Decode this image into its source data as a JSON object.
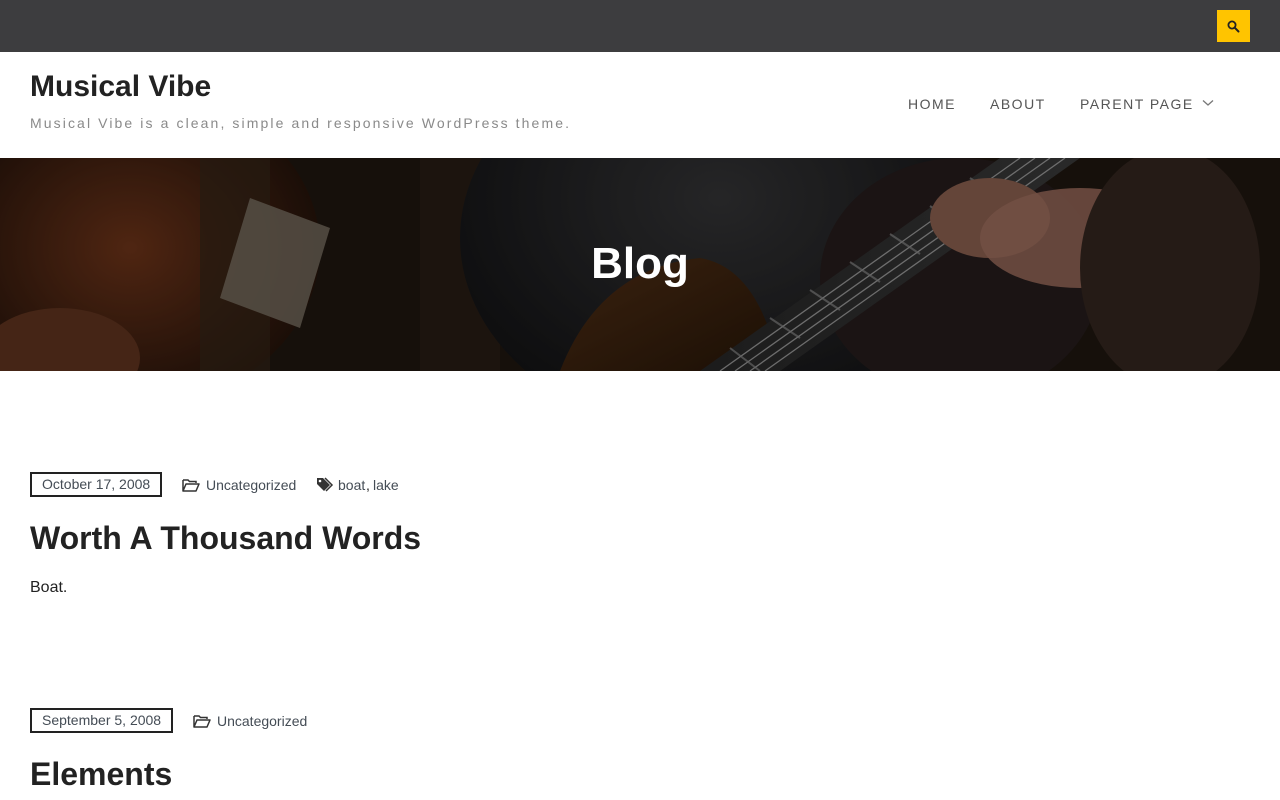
{
  "topbar": {
    "search_icon": "search-icon",
    "accent": "#ffc400"
  },
  "header": {
    "site_title": "Musical Vibe",
    "site_description": "Musical Vibe is a clean, simple and responsive WordPress theme."
  },
  "nav": {
    "items": [
      {
        "label": "HOME"
      },
      {
        "label": "ABOUT"
      },
      {
        "label": "PARENT PAGE",
        "has_submenu": true
      }
    ]
  },
  "hero": {
    "title": "Blog"
  },
  "posts": [
    {
      "date": "October 17, 2008",
      "category": "Uncategorized",
      "tags": [
        "boat",
        "lake"
      ],
      "tag_separator": ",",
      "title": "Worth A Thousand Words",
      "excerpt": "Boat."
    },
    {
      "date": "September 5, 2008",
      "category": "Uncategorized",
      "title": "Elements"
    }
  ]
}
